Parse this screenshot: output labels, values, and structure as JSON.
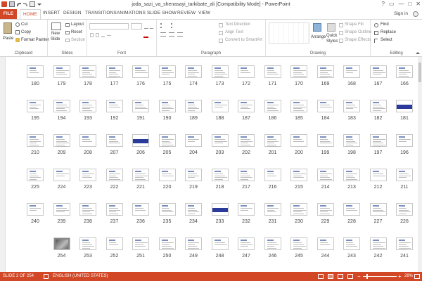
{
  "window": {
    "title": "joda_sazi_va_shenasayi_tarkibate_ali [Compatibility Mode] - PowerPoint",
    "controls": [
      "?",
      "▭",
      "—",
      "□",
      "✕"
    ]
  },
  "ribbon_tabs": [
    "FILE",
    "HOME",
    "INSERT",
    "DESIGN",
    "TRANSITIONS",
    "ANIMATIONS",
    "SLIDE SHOW",
    "REVIEW",
    "VIEW"
  ],
  "active_tab": "HOME",
  "signin": "Sign in",
  "accent_color": "#d24726",
  "clipboard": {
    "paste": "Paste",
    "cut": "Cut",
    "copy": "Copy",
    "format_painter": "Format Painter",
    "label": "Clipboard"
  },
  "slides_group": {
    "new_slide_1": "New",
    "new_slide_2": "Slide",
    "layout": "Layout",
    "reset": "Reset",
    "section": "Section",
    "label": "Slides"
  },
  "font_group": {
    "label": "Font"
  },
  "paragraph_group": {
    "text_direction": "Text Direction",
    "align_text": "Align Text",
    "convert_smartart": "Convert to SmartArt",
    "label": "Paragraph"
  },
  "drawing_group": {
    "arrange": "Arrange",
    "quick_styles_1": "Quick",
    "quick_styles_2": "Styles",
    "shape_fill": "Shape Fill",
    "shape_outline": "Shape Outline",
    "shape_effects": "Shape Effects",
    "label": "Drawing"
  },
  "editing_group": {
    "find": "Find",
    "replace": "Replace",
    "select": "Select",
    "label": "Editing"
  },
  "slide_rows": [
    [
      "180",
      "179",
      "178",
      "177",
      "176",
      "175",
      "174",
      "173",
      "172",
      "171",
      "170",
      "169",
      "168",
      "167",
      "166"
    ],
    [
      "195",
      "194",
      "193",
      "192",
      "191",
      "190",
      "189",
      "188",
      "187",
      "186",
      "185",
      "184",
      "183",
      "182",
      "181"
    ],
    [
      "210",
      "209",
      "208",
      "207",
      "206",
      "205",
      "204",
      "203",
      "202",
      "201",
      "200",
      "199",
      "198",
      "197",
      "196"
    ],
    [
      "225",
      "224",
      "223",
      "222",
      "221",
      "220",
      "219",
      "218",
      "217",
      "216",
      "215",
      "214",
      "213",
      "212",
      "211"
    ],
    [
      "240",
      "239",
      "238",
      "237",
      "236",
      "235",
      "234",
      "233",
      "232",
      "231",
      "230",
      "229",
      "228",
      "227",
      "226"
    ],
    [
      "",
      "254",
      "253",
      "252",
      "251",
      "250",
      "249",
      "248",
      "247",
      "246",
      "245",
      "244",
      "243",
      "242",
      "241"
    ]
  ],
  "status": {
    "slide_info": "SLIDE 2 OF 254",
    "language": "ENGLISH (UNITED STATES)",
    "zoom": "28%"
  }
}
